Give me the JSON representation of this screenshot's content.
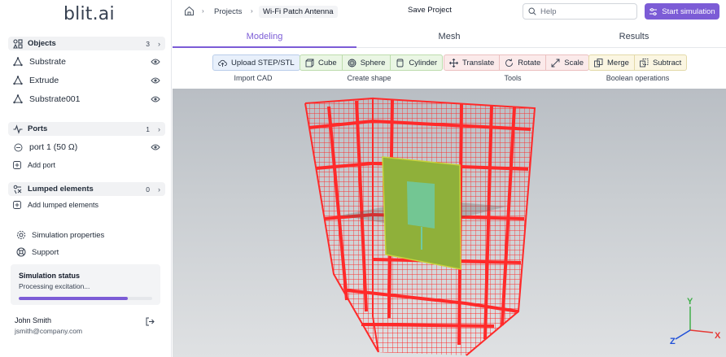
{
  "app": {
    "logo_text": "blit.ai"
  },
  "sidebar": {
    "objects": {
      "title": "Objects",
      "count": "3",
      "items": [
        {
          "label": "Substrate"
        },
        {
          "label": "Extrude"
        },
        {
          "label": "Substrate001"
        }
      ]
    },
    "ports": {
      "title": "Ports",
      "count": "1",
      "items": [
        {
          "label": "port 1 (50 Ω)"
        }
      ],
      "add_label": "Add port"
    },
    "lumped": {
      "title": "Lumped elements",
      "count": "0",
      "add_label": "Add lumped elements"
    },
    "links": {
      "simulation_properties": "Simulation properties",
      "support": "Support"
    },
    "status": {
      "title": "Simulation status",
      "text": "Processing excitation...",
      "progress": 0.82
    },
    "user": {
      "name": "John Smith",
      "email": "jsmith@company.com"
    }
  },
  "header": {
    "breadcrumb": {
      "projects": "Projects",
      "current": "Wi-Fi Patch Antenna"
    },
    "save_label": "Save Project",
    "search_placeholder": "Help",
    "start_label": "Start simulation"
  },
  "tabs": [
    {
      "label": "Modeling",
      "active": true
    },
    {
      "label": "Mesh",
      "active": false
    },
    {
      "label": "Results",
      "active": false
    }
  ],
  "toolbar": {
    "import": {
      "label": "Import CAD",
      "buttons": [
        "Upload STEP/STL"
      ]
    },
    "create": {
      "label": "Create shape",
      "buttons": [
        "Cube",
        "Sphere",
        "Cylinder"
      ]
    },
    "tools": {
      "label": "Tools",
      "buttons": [
        "Translate",
        "Rotate",
        "Scale"
      ]
    },
    "boolean": {
      "label": "Boolean operations",
      "buttons": [
        "Merge",
        "Subtract"
      ]
    }
  },
  "viewport": {
    "axes": {
      "x": "X",
      "y": "Y",
      "z": "Z"
    }
  },
  "colors": {
    "accent": "#7c5cd6",
    "mesh": "#ff2a2a",
    "substrate": "#8fb03a",
    "patch": "#6fcaa3"
  }
}
